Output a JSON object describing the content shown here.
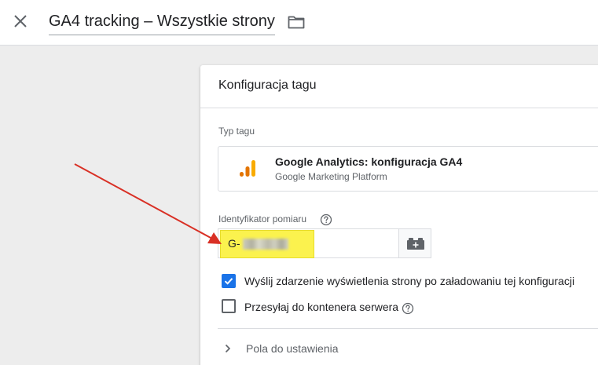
{
  "topbar": {
    "title": "GA4 tracking – Wszystkie strony",
    "close_icon": "close-icon",
    "folder_icon": "folder-icon"
  },
  "panel": {
    "title": "Konfiguracja tagu",
    "tag_type": {
      "label": "Typ tagu",
      "name": "Google Analytics: konfiguracja GA4",
      "vendor": "Google Marketing Platform",
      "icon": "google-analytics-icon"
    },
    "measurement_id": {
      "label": "Identyfikator pomiaru",
      "prefix": "G-",
      "help_icon": "help-icon",
      "variable_icon": "variable-picker-icon",
      "highlight_color": "#fbf24e"
    },
    "checkboxes": [
      {
        "label": "Wyślij zdarzenie wyświetlenia strony po załadowaniu tej konfiguracji",
        "checked": true
      },
      {
        "label": "Przesyłaj do kontenera serwera",
        "checked": false
      }
    ],
    "fields_to_set": {
      "label": "Pola do ustawienia"
    }
  },
  "colors": {
    "accent": "#1a73e8",
    "annotation_arrow": "#d93025",
    "ga_orange": "#f9ab00",
    "ga_dark_orange": "#e37400"
  }
}
